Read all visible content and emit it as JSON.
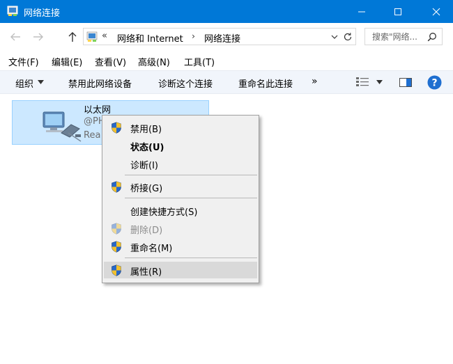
{
  "window": {
    "title": "网络连接",
    "accent": "#0078d7"
  },
  "nav": {
    "back_icon": "arrow-left-icon",
    "forward_icon": "arrow-right-icon",
    "up_icon": "arrow-up-icon"
  },
  "address": {
    "chevrons": "«",
    "crumbs": [
      "网络和 Internet",
      "网络连接"
    ],
    "separator": "›"
  },
  "search": {
    "placeholder": "搜索\"网络..."
  },
  "menu": {
    "items": [
      "文件(F)",
      "编辑(E)",
      "查看(V)",
      "高级(N)",
      "工具(T)"
    ]
  },
  "toolbar": {
    "organize": "组织",
    "disable": "禁用此网络设备",
    "diagnose": "诊断这个连接",
    "rename": "重命名此连接",
    "more": "»"
  },
  "connection": {
    "name": "以太网",
    "line2": "@PH",
    "line3": "Rea"
  },
  "context_menu": {
    "items": [
      {
        "label": "禁用(B)",
        "shield": true,
        "bold": false,
        "disabled": false
      },
      {
        "label": "状态(U)",
        "shield": false,
        "bold": true,
        "disabled": false
      },
      {
        "label": "诊断(I)",
        "shield": false,
        "bold": false,
        "disabled": false
      },
      {
        "label": "桥接(G)",
        "shield": true,
        "bold": false,
        "disabled": false
      },
      {
        "label": "创建快捷方式(S)",
        "shield": false,
        "bold": false,
        "disabled": false
      },
      {
        "label": "删除(D)",
        "shield": true,
        "bold": false,
        "disabled": true
      },
      {
        "label": "重命名(M)",
        "shield": true,
        "bold": false,
        "disabled": false
      },
      {
        "label": "属性(R)",
        "shield": true,
        "bold": false,
        "disabled": false,
        "highlighted": true
      }
    ]
  },
  "colors": {
    "selection_bg": "#cce8ff",
    "toolbar_bg": "#f1f5fb",
    "help_blue": "#1f6fd0"
  }
}
